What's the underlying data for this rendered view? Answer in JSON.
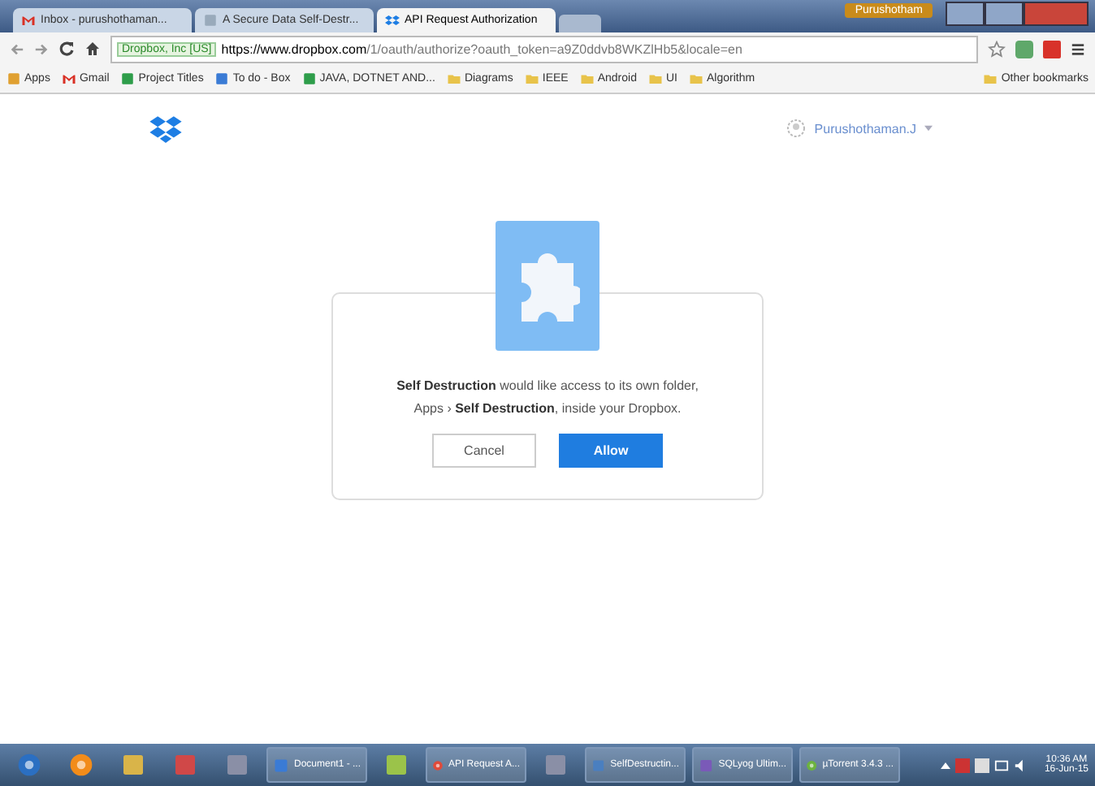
{
  "browser": {
    "tabs": [
      {
        "title": "Inbox - purushothaman...",
        "kind": "mail",
        "selected": false
      },
      {
        "title": "A Secure Data Self-Destr...",
        "kind": "page",
        "selected": false
      },
      {
        "title": "API Request Authorization",
        "kind": "dropbox",
        "selected": true
      }
    ],
    "profile": "Purushotham",
    "address": {
      "site": "Dropbox, Inc [US]",
      "url_host": "https://www.dropbox.com",
      "url_rest": "/1/oauth/authorize?oauth_token=a9Z0ddvb8WKZlHb5&locale=en"
    },
    "bookmarks": [
      {
        "label": "Apps",
        "kind": "apps"
      },
      {
        "label": "Gmail",
        "kind": "mail"
      },
      {
        "label": "Project Titles",
        "kind": "sheet"
      },
      {
        "label": "To do - Box",
        "kind": "doc"
      },
      {
        "label": "JAVA, DOTNET AND...",
        "kind": "sheet"
      },
      {
        "label": "Diagrams",
        "kind": "folder"
      },
      {
        "label": "IEEE",
        "kind": "folder"
      },
      {
        "label": "Android",
        "kind": "folder"
      },
      {
        "label": "UI",
        "kind": "folder"
      },
      {
        "label": "Algorithm",
        "kind": "folder"
      }
    ],
    "other_bookmarks": "Other bookmarks"
  },
  "page": {
    "user": "Purushothaman.J",
    "dialog": {
      "message_line1": "**Self Destruction** would like access to its own folder,",
      "message_line2": "Apps › **Self Destruction**, inside your Dropbox.",
      "cancel": "Cancel",
      "allow": "Allow"
    }
  },
  "taskbar": {
    "items": [
      {
        "kind": "start"
      },
      {
        "kind": "orange"
      },
      {
        "kind": "files"
      },
      {
        "kind": "grid"
      },
      {
        "kind": "tool"
      },
      {
        "kind": "doc",
        "label": "Document1 - ..."
      },
      {
        "kind": "notes"
      },
      {
        "kind": "chrome",
        "label": "API Request A..."
      },
      {
        "kind": "tool"
      },
      {
        "kind": "cube",
        "label": "SelfDestructin..."
      },
      {
        "kind": "dolphin",
        "label": "SQLyog Ultim..."
      },
      {
        "kind": "torrent",
        "label": "µTorrent 3.4.3 ..."
      }
    ],
    "time": "10:36 AM",
    "date": "16-Jun-15"
  }
}
